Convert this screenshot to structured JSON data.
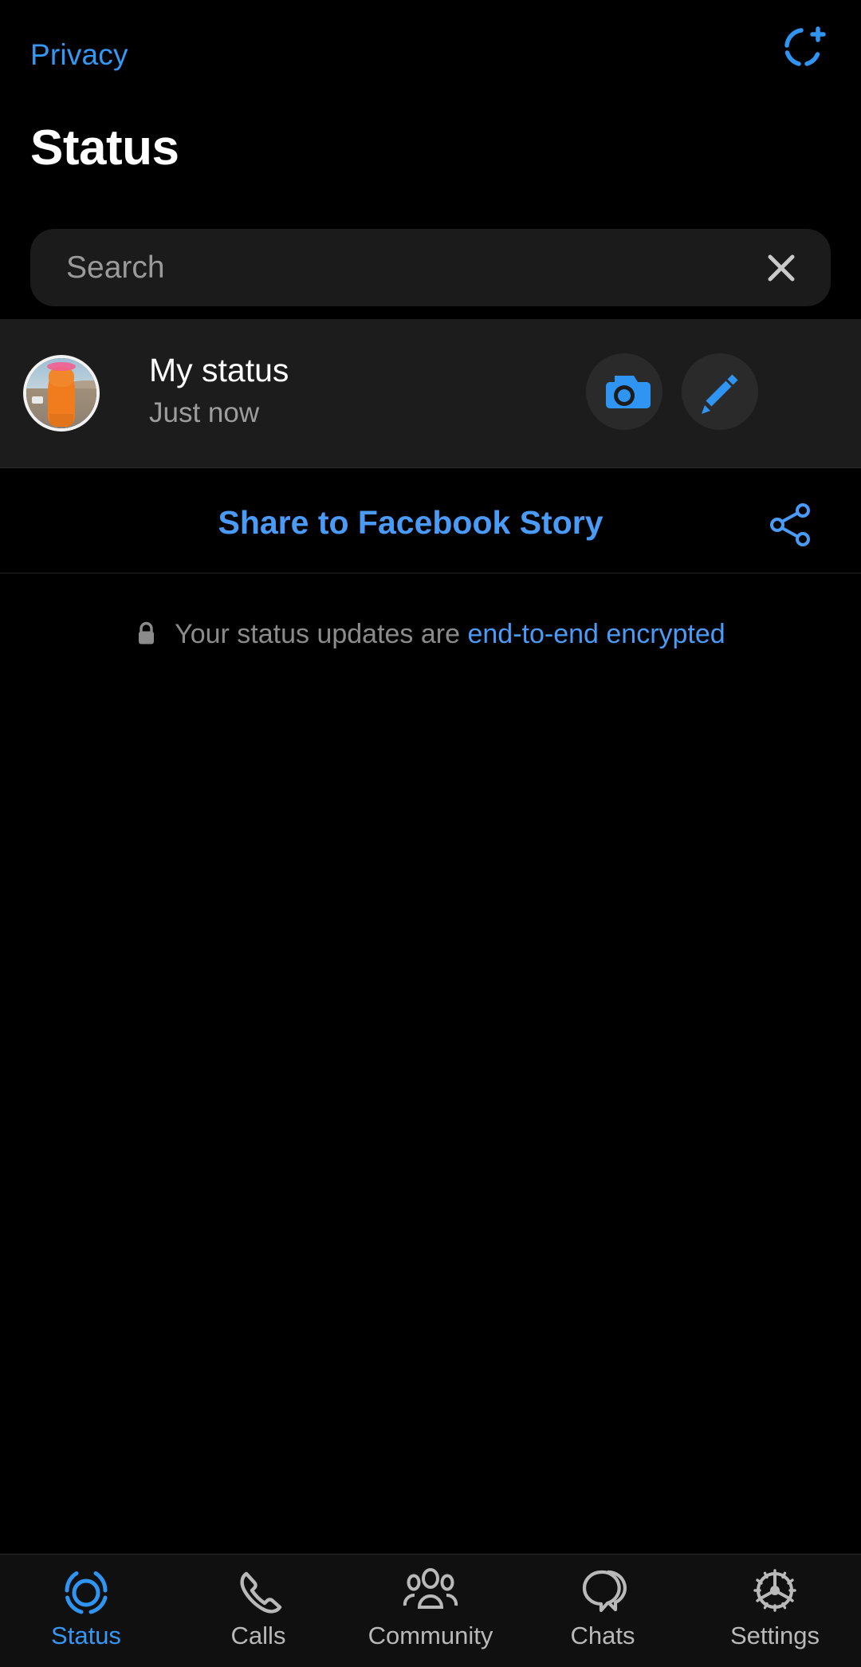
{
  "theme": {
    "background": "#000000",
    "row_background": "#1c1c1c",
    "accent_blue": "#3498f4",
    "link_blue": "#4a9bf7",
    "muted_text": "#9a9a9a",
    "nav_background": "#101010",
    "search_background": "#1b1b1b"
  },
  "topbar": {
    "privacy_label": "Privacy",
    "add_status_icon": "add-status-ring-plus-icon"
  },
  "header": {
    "title": "Status"
  },
  "search": {
    "placeholder": "Search",
    "value": "",
    "clear_icon": "close-x-icon"
  },
  "my_status": {
    "title": "My status",
    "subtitle": "Just now",
    "avatar_icon": "avatar",
    "avatar_description": "orange dinosaur toy on sand",
    "camera_icon": "camera-icon",
    "pencil_icon": "pencil-icon"
  },
  "share": {
    "label": "Share to Facebook Story",
    "share_icon": "share-nodes-icon"
  },
  "encryption": {
    "lock_icon": "lock-icon",
    "text": "Your status updates are",
    "link_text": "end-to-end encrypted"
  },
  "bottom_nav": {
    "items": [
      {
        "label": "Status",
        "icon": "status-ring-icon",
        "active": true
      },
      {
        "label": "Calls",
        "icon": "phone-icon",
        "active": false
      },
      {
        "label": "Community",
        "icon": "community-icon",
        "active": false
      },
      {
        "label": "Chats",
        "icon": "chats-bubbles-icon",
        "active": false
      },
      {
        "label": "Settings",
        "icon": "gear-icon",
        "active": false
      }
    ]
  }
}
